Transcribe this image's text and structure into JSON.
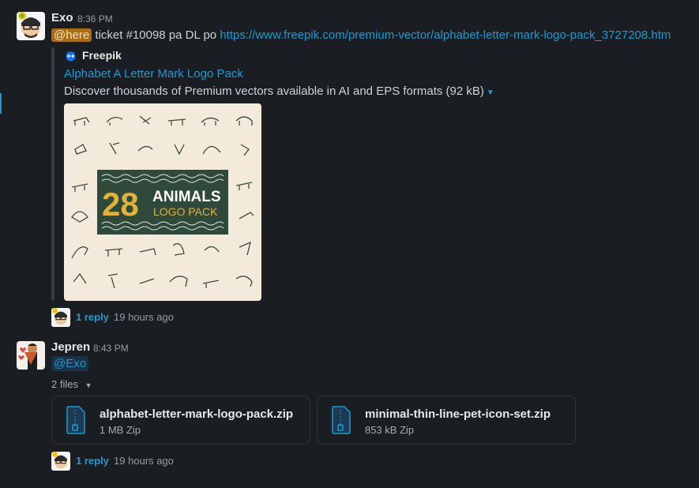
{
  "messages": [
    {
      "author": "Exo",
      "time": "8:36 PM",
      "text_mention": "@here",
      "text_body": " ticket #10098 pa DL po ",
      "text_link": "https://www.freepik.com/premium-vector/alphabet-letter-mark-logo-pack_3727208.htm",
      "unfurl": {
        "source": "Freepik",
        "title": "Alphabet A Letter Mark Logo Pack",
        "description": "Discover thousands of Premium vectors available in AI and EPS formats (92 kB)",
        "preview": {
          "number": "28",
          "heading": "ANIMALS",
          "subheading": "LOGO PACK"
        }
      },
      "thread": {
        "reply_count": "1 reply",
        "last_reply": "19 hours ago"
      }
    },
    {
      "author": "Jepren",
      "time": "8:43 PM",
      "mention": "@Exo",
      "files_toggle": "2 files",
      "files": [
        {
          "name": "alphabet-letter-mark-logo-pack.zip",
          "meta": "1 MB Zip"
        },
        {
          "name": "minimal-thin-line-pet-icon-set.zip",
          "meta": "853 kB Zip"
        }
      ],
      "thread": {
        "reply_count": "1 reply",
        "last_reply": "19 hours ago"
      }
    }
  ],
  "colors": {
    "background": "#1a1d21",
    "link": "#1d9bd1",
    "here_mention_bg": "#a96c10",
    "preview_bg": "#f4eadc",
    "preview_panel": "#2f4a3a",
    "preview_gold": "#e0b23c"
  },
  "icons": [
    "freepik-logo-icon",
    "zip-file-icon",
    "caret-down-icon"
  ]
}
